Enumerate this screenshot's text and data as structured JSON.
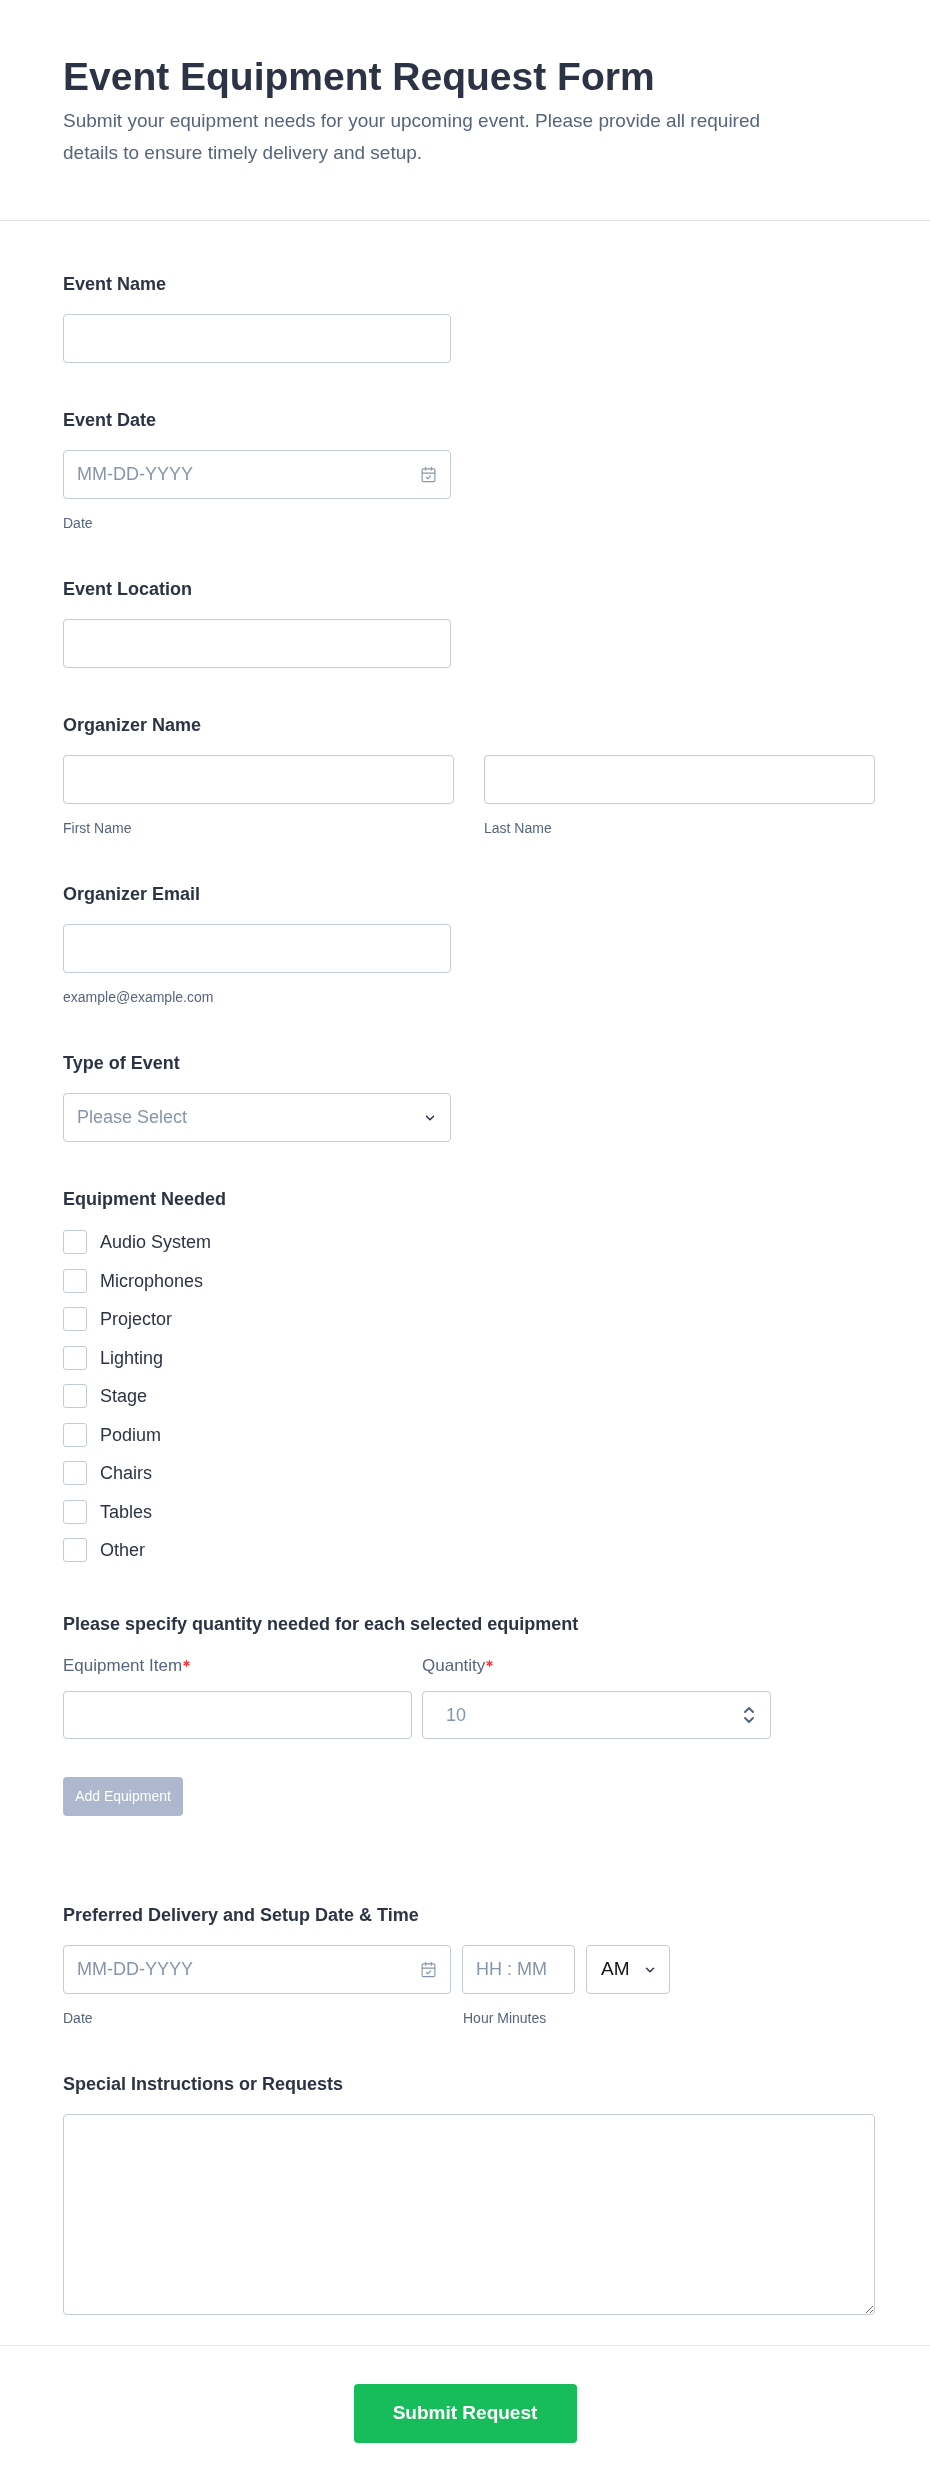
{
  "header": {
    "title": "Event Equipment Request Form",
    "description": "Submit your equipment needs for your upcoming event. Please provide all required details to ensure timely delivery and setup."
  },
  "fields": [
    {
      "kind": "text",
      "label": "Event Name"
    },
    {
      "kind": "date",
      "label": "Event Date",
      "placeholder": "MM-DD-YYYY",
      "sublabel": "Date"
    },
    {
      "kind": "text",
      "label": "Event Location"
    },
    {
      "kind": "name",
      "label": "Organizer Name",
      "inputs": [
        {
          "sublabel": "First Name"
        },
        {
          "sublabel": "Last Name"
        }
      ]
    },
    {
      "kind": "email",
      "label": "Organizer Email",
      "sublabel": "example@example.com"
    },
    {
      "kind": "select",
      "label": "Type of Event",
      "placeholder": "Please Select"
    },
    {
      "kind": "checkboxes",
      "label": "Equipment Needed",
      "options": [
        {
          "label": "Audio System",
          "checked": false
        },
        {
          "label": "Microphones",
          "checked": false
        },
        {
          "label": "Projector",
          "checked": false
        },
        {
          "label": "Lighting",
          "checked": false
        },
        {
          "label": "Stage",
          "checked": false
        },
        {
          "label": "Podium",
          "checked": false
        },
        {
          "label": "Chairs",
          "checked": false
        },
        {
          "label": "Tables",
          "checked": false
        },
        {
          "label": "Other",
          "checked": false
        }
      ]
    },
    {
      "kind": "repeater",
      "label": "Please specify quantity needed for each selected equipment",
      "columns": [
        {
          "kind": "text",
          "label": "Equipment Item",
          "required": true
        },
        {
          "kind": "number",
          "label": "Quantity",
          "required": true,
          "placeholder": "10"
        }
      ],
      "button": {
        "label": "Add Equipment",
        "disabled": true
      }
    },
    {
      "kind": "datetime",
      "label": "Preferred Delivery and Setup Date & Time",
      "date": {
        "placeholder": "MM-DD-YYYY",
        "sublabel": "Date"
      },
      "time": {
        "placeholder": "HH : MM",
        "sublabel": "Hour Minutes"
      },
      "period": {
        "value": "AM"
      }
    },
    {
      "kind": "textarea",
      "label": "Special Instructions or Requests"
    }
  ],
  "footer": {
    "submit_button": "Submit Request"
  }
}
